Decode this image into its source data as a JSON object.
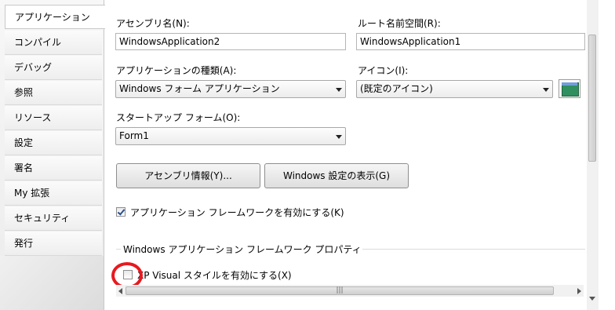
{
  "sidebar": {
    "tabs": [
      {
        "label": "アプリケーション",
        "active": true
      },
      {
        "label": "コンパイル"
      },
      {
        "label": "デバッグ"
      },
      {
        "label": "参照"
      },
      {
        "label": "リソース"
      },
      {
        "label": "設定"
      },
      {
        "label": "署名"
      },
      {
        "label": "My 拡張"
      },
      {
        "label": "セキュリティ"
      },
      {
        "label": "発行"
      }
    ]
  },
  "form": {
    "assembly_name_label": "アセンブリ名(N):",
    "assembly_name_value": "WindowsApplication2",
    "root_namespace_label": "ルート名前空間(R):",
    "root_namespace_value": "WindowsApplication1",
    "app_type_label": "アプリケーションの種類(A):",
    "app_type_value": "Windows フォーム アプリケーション",
    "icon_label": "アイコン(I):",
    "icon_value": "(既定のアイコン)",
    "startup_form_label": "スタートアップ フォーム(O):",
    "startup_form_value": "Form1",
    "assembly_info_button": "アセンブリ情報(Y)...",
    "windows_settings_button": "Windows 設定の表示(G)",
    "enable_framework_label": "アプリケーション フレームワークを有効にする(K)",
    "enable_framework_checked": true,
    "framework_group_title": "Windows アプリケーション フレームワーク プロパティ",
    "xp_visual_label": "XP Visual スタイルを有効にする(X)",
    "xp_visual_checked": false
  },
  "scrollbar": {
    "h_grip": "|||"
  },
  "colors": {
    "highlight": "#e8191f",
    "checkmark": "#2a4f8e"
  }
}
